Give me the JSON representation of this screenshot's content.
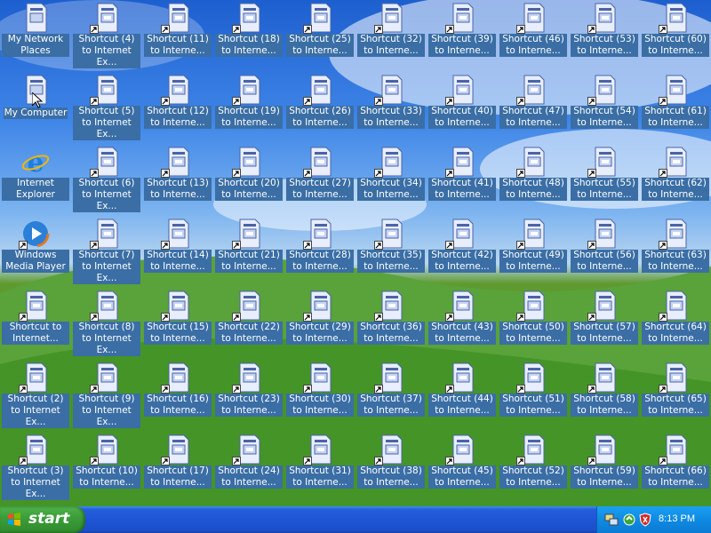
{
  "desktop": {
    "icons": [
      {
        "label": "My Network Places",
        "type": "network"
      },
      {
        "label": "My Computer",
        "type": "computer"
      },
      {
        "label": "Internet Explorer",
        "type": "ie"
      },
      {
        "label": "Windows Media Player",
        "type": "wmp"
      },
      {
        "label": "Shortcut to Internet...",
        "type": "doc"
      },
      {
        "label": "Shortcut (2) to Internet Ex...",
        "type": "doc"
      },
      {
        "label": "Shortcut (3) to Internet Ex...",
        "type": "doc"
      },
      {
        "label": "Shortcut (4) to Internet Ex...",
        "type": "doc"
      },
      {
        "label": "Shortcut (5) to Internet Ex...",
        "type": "doc"
      },
      {
        "label": "Shortcut (6) to Internet Ex...",
        "type": "doc"
      },
      {
        "label": "Shortcut (7) to Internet Ex...",
        "type": "doc"
      },
      {
        "label": "Shortcut (8) to Internet Ex...",
        "type": "doc"
      },
      {
        "label": "Shortcut (9) to Internet Ex...",
        "type": "doc"
      },
      {
        "label": "Shortcut (10) to Interne...",
        "type": "doc"
      },
      {
        "label": "Shortcut (11) to Interne...",
        "type": "doc"
      },
      {
        "label": "Shortcut (12) to Interne...",
        "type": "doc"
      },
      {
        "label": "Shortcut (13) to Interne...",
        "type": "doc"
      },
      {
        "label": "Shortcut (14) to Interne...",
        "type": "doc"
      },
      {
        "label": "Shortcut (15) to Interne...",
        "type": "doc"
      },
      {
        "label": "Shortcut (16) to Interne...",
        "type": "doc"
      },
      {
        "label": "Shortcut (17) to Interne...",
        "type": "doc"
      },
      {
        "label": "Shortcut (18) to Interne...",
        "type": "doc"
      },
      {
        "label": "Shortcut (19) to Interne...",
        "type": "doc"
      },
      {
        "label": "Shortcut (20) to Interne...",
        "type": "doc"
      },
      {
        "label": "Shortcut (21) to Interne...",
        "type": "doc"
      },
      {
        "label": "Shortcut (22) to Interne...",
        "type": "doc"
      },
      {
        "label": "Shortcut (23) to Interne...",
        "type": "doc"
      },
      {
        "label": "Shortcut (24) to Interne...",
        "type": "doc"
      },
      {
        "label": "Shortcut (25) to Interne...",
        "type": "doc"
      },
      {
        "label": "Shortcut (26) to Interne...",
        "type": "doc"
      },
      {
        "label": "Shortcut (27) to Interne...",
        "type": "doc"
      },
      {
        "label": "Shortcut (28) to Interne...",
        "type": "doc"
      },
      {
        "label": "Shortcut (29) to Interne...",
        "type": "doc"
      },
      {
        "label": "Shortcut (30) to Interne...",
        "type": "doc"
      },
      {
        "label": "Shortcut (31) to Interne...",
        "type": "doc"
      },
      {
        "label": "Shortcut (32) to Interne...",
        "type": "doc"
      },
      {
        "label": "Shortcut (33) to Interne...",
        "type": "doc"
      },
      {
        "label": "Shortcut (34) to Interne...",
        "type": "doc"
      },
      {
        "label": "Shortcut (35) to Interne...",
        "type": "doc"
      },
      {
        "label": "Shortcut (36) to Interne...",
        "type": "doc"
      },
      {
        "label": "Shortcut (37) to Interne...",
        "type": "doc"
      },
      {
        "label": "Shortcut (38) to Interne...",
        "type": "doc"
      },
      {
        "label": "Shortcut (39) to Interne...",
        "type": "doc"
      },
      {
        "label": "Shortcut (40) to Interne...",
        "type": "doc"
      },
      {
        "label": "Shortcut (41) to Interne...",
        "type": "doc"
      },
      {
        "label": "Shortcut (42) to Interne...",
        "type": "doc"
      },
      {
        "label": "Shortcut (43) to Interne...",
        "type": "doc"
      },
      {
        "label": "Shortcut (44) to Interne...",
        "type": "doc"
      },
      {
        "label": "Shortcut (45) to Interne...",
        "type": "doc"
      },
      {
        "label": "Shortcut (46) to Interne...",
        "type": "doc"
      },
      {
        "label": "Shortcut (47) to Interne...",
        "type": "doc"
      },
      {
        "label": "Shortcut (48) to Interne...",
        "type": "doc"
      },
      {
        "label": "Shortcut (49) to Interne...",
        "type": "doc"
      },
      {
        "label": "Shortcut (50) to Interne...",
        "type": "doc"
      },
      {
        "label": "Shortcut (51) to Interne...",
        "type": "doc"
      },
      {
        "label": "Shortcut (52) to Interne...",
        "type": "doc"
      },
      {
        "label": "Shortcut (53) to Interne...",
        "type": "doc"
      },
      {
        "label": "Shortcut (54) to Interne...",
        "type": "doc"
      },
      {
        "label": "Shortcut (55) to Interne...",
        "type": "doc"
      },
      {
        "label": "Shortcut (56) to Interne...",
        "type": "doc"
      },
      {
        "label": "Shortcut (57) to Interne...",
        "type": "doc"
      },
      {
        "label": "Shortcut (58) to Interne...",
        "type": "doc"
      },
      {
        "label": "Shortcut (59) to Interne...",
        "type": "doc"
      },
      {
        "label": "Shortcut (60) to Interne...",
        "type": "doc"
      },
      {
        "label": "Shortcut (61) to Interne...",
        "type": "doc"
      },
      {
        "label": "Shortcut (62) to Interne...",
        "type": "doc"
      },
      {
        "label": "Shortcut (63) to Interne...",
        "type": "doc"
      },
      {
        "label": "Shortcut (64) to Interne...",
        "type": "doc"
      },
      {
        "label": "Shortcut (65) to Interne...",
        "type": "doc"
      },
      {
        "label": "Shortcut (66) to Interne...",
        "type": "doc"
      }
    ]
  },
  "taskbar": {
    "start_label": "start",
    "tray_icons": [
      "network-icon",
      "windows-update-icon",
      "security-shield-icon"
    ],
    "clock": "8:13 PM"
  },
  "colors": {
    "label_bg": "#3a6ea5",
    "taskbar": "#245edb",
    "start_button": "#3c9e3a",
    "tray": "#0f8ae3"
  }
}
